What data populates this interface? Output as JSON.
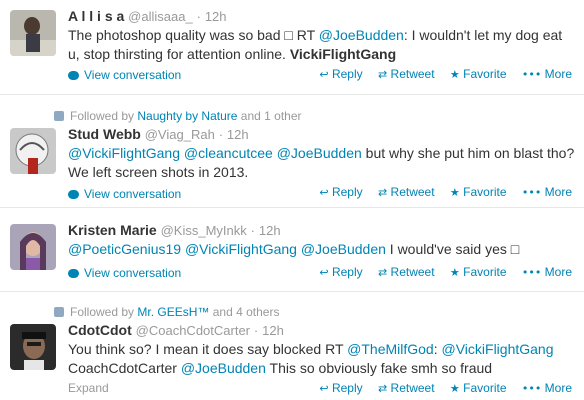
{
  "tweets": [
    {
      "fullname": "A l l i s a",
      "username": "@allisaaa_",
      "time": "12h",
      "text_parts": [
        "The photoshop quality was so bad ",
        "□",
        " RT ",
        "@JoeBudden",
        ": I wouldn't let my dog eat u, stop thirsting for attention online. ",
        "VickiFlightGang"
      ],
      "link": "View conversation",
      "actions": {
        "reply": "Reply",
        "retweet": "Retweet",
        "favorite": "Favorite",
        "more": "More"
      }
    },
    {
      "context": {
        "prefix": "Followed by",
        "name": "Naughty by Nature",
        "suffix": "and 1 other"
      },
      "fullname": "Stud Webb",
      "username": "@Viag_Rah",
      "time": "12h",
      "text_parts": [
        "@VickiFlightGang",
        " ",
        "@cleancutcee",
        " ",
        "@JoeBudden",
        " but why she put him on blast tho? We left screen shots in 2013."
      ],
      "link": "View conversation",
      "actions": {
        "reply": "Reply",
        "retweet": "Retweet",
        "favorite": "Favorite",
        "more": "More"
      }
    },
    {
      "fullname": "Kristen Marie",
      "username": "@Kiss_MyInkk",
      "time": "12h",
      "text_parts": [
        "@PoeticGenius19",
        " ",
        "@VickiFlightGang",
        " ",
        "@JoeBudden",
        " I would've said yes ",
        "□"
      ],
      "link": "View conversation",
      "actions": {
        "reply": "Reply",
        "retweet": "Retweet",
        "favorite": "Favorite",
        "more": "More"
      }
    },
    {
      "context": {
        "prefix": "Followed by",
        "name": "Mr. GEEsH™",
        "suffix": "and 4 others"
      },
      "fullname": "CdotCdot",
      "username": "@CoachCdotCarter",
      "time": "12h",
      "text_parts": [
        "You think so? I mean it does say blocked RT ",
        "@TheMilfGod",
        ": ",
        "@VickiFlightGang",
        " CoachCdotCarter ",
        "@JoeBudden",
        " This so obviously fake smh so fraud"
      ],
      "link": "Expand",
      "actions": {
        "reply": "Reply",
        "retweet": "Retweet",
        "favorite": "Favorite",
        "more": "More"
      }
    }
  ]
}
